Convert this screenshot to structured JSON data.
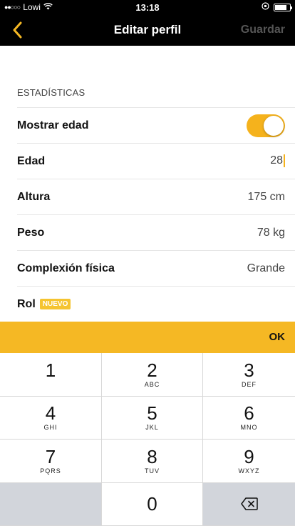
{
  "status_bar": {
    "carrier": "Lowi",
    "signal": "●●○○○",
    "time": "13:18"
  },
  "nav": {
    "title": "Editar perfil",
    "save_label": "Guardar"
  },
  "section": {
    "header": "ESTADÍSTICAS"
  },
  "rows": {
    "show_age": {
      "label": "Mostrar edad",
      "toggle_on": true
    },
    "age": {
      "label": "Edad",
      "value": "28"
    },
    "height": {
      "label": "Altura",
      "value": "175 cm"
    },
    "weight": {
      "label": "Peso",
      "value": "78 kg"
    },
    "build": {
      "label": "Complexión física",
      "value": "Grande"
    },
    "role": {
      "label": "Rol",
      "badge": "NUEVO"
    }
  },
  "keyboard": {
    "ok_label": "OK",
    "keys": [
      {
        "num": "1",
        "letters": ""
      },
      {
        "num": "2",
        "letters": "ABC"
      },
      {
        "num": "3",
        "letters": "DEF"
      },
      {
        "num": "4",
        "letters": "GHI"
      },
      {
        "num": "5",
        "letters": "JKL"
      },
      {
        "num": "6",
        "letters": "MNO"
      },
      {
        "num": "7",
        "letters": "PQRS"
      },
      {
        "num": "8",
        "letters": "TUV"
      },
      {
        "num": "9",
        "letters": "WXYZ"
      },
      {
        "num": "0",
        "letters": ""
      }
    ]
  },
  "colors": {
    "accent": "#f5b824",
    "nav_bg": "#000000"
  }
}
